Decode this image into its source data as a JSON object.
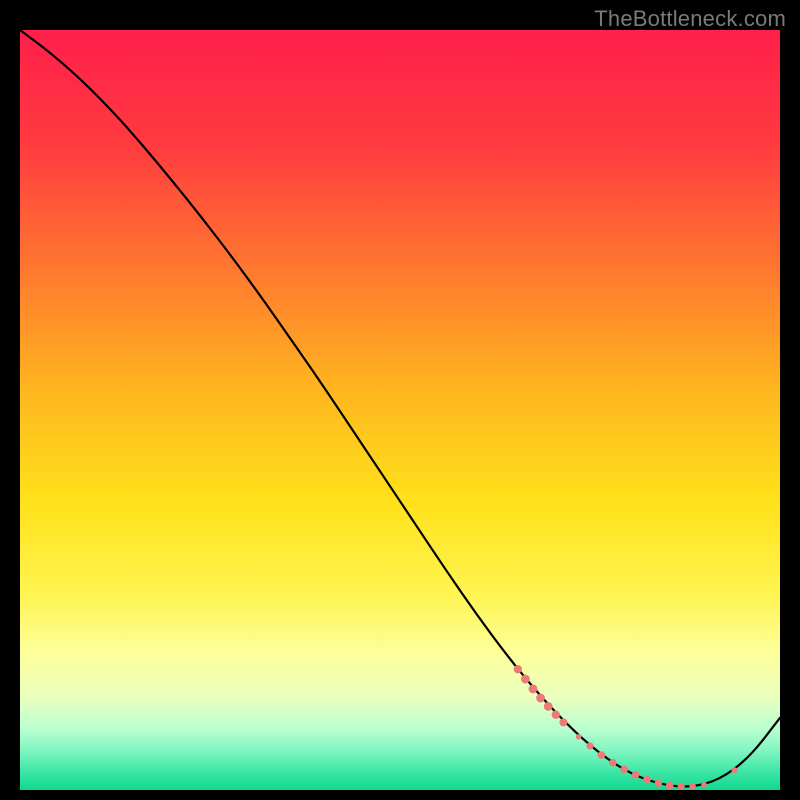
{
  "watermark": "TheBottleneck.com",
  "chart_data": {
    "type": "line",
    "title": "",
    "xlabel": "",
    "ylabel": "",
    "xlim": [
      0,
      100
    ],
    "ylim": [
      0,
      100
    ],
    "grid": false,
    "background_gradient_stops": [
      {
        "offset": 0.0,
        "color": "#ff1f4b"
      },
      {
        "offset": 0.15,
        "color": "#ff3a3f"
      },
      {
        "offset": 0.32,
        "color": "#ff7a2f"
      },
      {
        "offset": 0.48,
        "color": "#ffb81f"
      },
      {
        "offset": 0.62,
        "color": "#ffe11a"
      },
      {
        "offset": 0.74,
        "color": "#fff450"
      },
      {
        "offset": 0.82,
        "color": "#fdff9a"
      },
      {
        "offset": 0.88,
        "color": "#e8ffc0"
      },
      {
        "offset": 0.92,
        "color": "#b8ffcf"
      },
      {
        "offset": 0.95,
        "color": "#7cf5c0"
      },
      {
        "offset": 0.975,
        "color": "#3fe6a7"
      },
      {
        "offset": 1.0,
        "color": "#0fd98f"
      }
    ],
    "curve": {
      "x": [
        0,
        4,
        8,
        12,
        16,
        20,
        24,
        28,
        32,
        36,
        40,
        44,
        48,
        52,
        56,
        60,
        64,
        68,
        72,
        76,
        80,
        84,
        88,
        92,
        96,
        100
      ],
      "y": [
        100,
        97,
        93.5,
        89.5,
        85,
        80.2,
        75.2,
        70,
        64.5,
        58.8,
        53,
        47,
        41,
        35,
        29,
        23.2,
        17.8,
        12.9,
        8.6,
        5,
        2.3,
        0.8,
        0.3,
        1.3,
        4.3,
        9.5
      ],
      "stroke": "#000000"
    },
    "dot_cluster": {
      "fill": "#ec7a77",
      "points": [
        {
          "x": 65.5,
          "y": 15.9,
          "r": 4.2
        },
        {
          "x": 66.5,
          "y": 14.6,
          "r": 4.4
        },
        {
          "x": 67.5,
          "y": 13.3,
          "r": 4.4
        },
        {
          "x": 68.5,
          "y": 12.1,
          "r": 4.4
        },
        {
          "x": 69.5,
          "y": 11.0,
          "r": 4.4
        },
        {
          "x": 70.5,
          "y": 9.9,
          "r": 4.2
        },
        {
          "x": 71.5,
          "y": 8.9,
          "r": 4.0
        },
        {
          "x": 73.5,
          "y": 7.0,
          "r": 2.8
        },
        {
          "x": 75.0,
          "y": 5.8,
          "r": 3.6
        },
        {
          "x": 76.5,
          "y": 4.6,
          "r": 3.8
        },
        {
          "x": 78.0,
          "y": 3.6,
          "r": 3.8
        },
        {
          "x": 79.5,
          "y": 2.7,
          "r": 3.8
        },
        {
          "x": 81.0,
          "y": 2.0,
          "r": 3.8
        },
        {
          "x": 82.5,
          "y": 1.4,
          "r": 3.8
        },
        {
          "x": 84.0,
          "y": 0.9,
          "r": 3.8
        },
        {
          "x": 85.5,
          "y": 0.6,
          "r": 3.8
        },
        {
          "x": 87.0,
          "y": 0.5,
          "r": 3.6
        },
        {
          "x": 88.5,
          "y": 0.5,
          "r": 3.2
        },
        {
          "x": 90.0,
          "y": 0.7,
          "r": 2.8
        },
        {
          "x": 94.0,
          "y": 2.6,
          "r": 3.0
        }
      ]
    }
  }
}
